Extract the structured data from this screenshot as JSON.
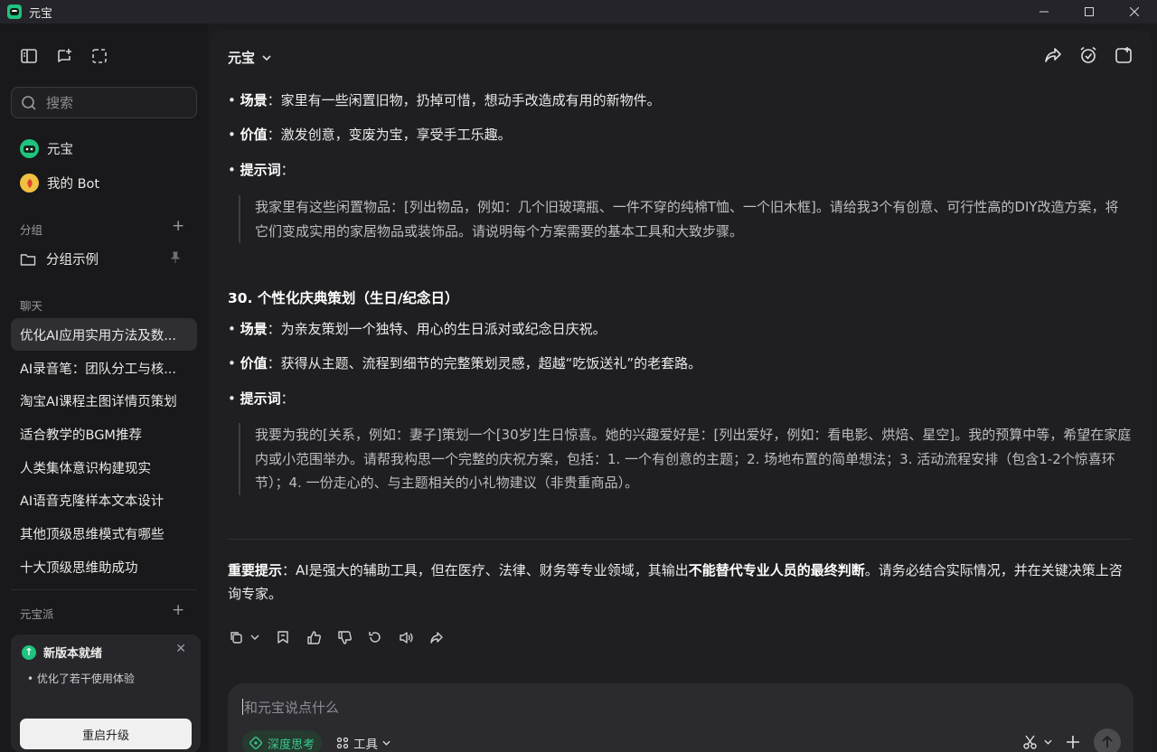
{
  "window": {
    "title": "元宝"
  },
  "sidebar": {
    "search_placeholder": "搜索",
    "nav": [
      {
        "label": "元宝",
        "icon": "yuanbao-logo-icon"
      },
      {
        "label": "我的 Bot",
        "icon": "bot-avatar-icon"
      }
    ],
    "groups_label": "分组",
    "group_example": "分组示例",
    "chats_label": "聊天",
    "chats": [
      "优化AI应用实用方法及数...",
      "AI录音笔：团队分工与核...",
      "淘宝AI课程主图详情页策划",
      "适合教学的BGM推荐",
      "人类集体意识构建现实",
      "AI语音克隆样本文本设计",
      "其他顶级思维模式有哪些",
      "十大顶级思维助成功"
    ],
    "yuanbao_pai_label": "元宝派",
    "update": {
      "title": "新版本就绪",
      "item": "优化了若干使用体验",
      "button": "重启升级"
    }
  },
  "main": {
    "model": "元宝",
    "b1_label": "场景",
    "b1_text": "：家里有一些闲置旧物，扔掉可惜，想动手改造成有用的新物件。",
    "b2_label": "价值",
    "b2_text": "：激发创意，变废为宝，享受手工乐趣。",
    "b3_label": "提示词",
    "b3_text": "：",
    "q1": "我家里有这些闲置物品：[列出物品，例如：几个旧玻璃瓶、一件不穿的纯棉T恤、一个旧木框]。请给我3个有创意、可行性高的DIY改造方案，将它们变成实用的家居物品或装饰品。请说明每个方案需要的基本工具和大致步骤。",
    "heading30": "30. 个性化庆典策划（生日/纪念日）",
    "c1_label": "场景",
    "c1_text": "：为亲友策划一个独特、用心的生日派对或纪念日庆祝。",
    "c2_label": "价值",
    "c2_text": "：获得从主题、流程到细节的完整策划灵感，超越“吃饭送礼”的老套路。",
    "c3_label": "提示词",
    "c3_text": "：",
    "q2": "我要为我的[关系，例如：妻子]策划一个[30岁]生日惊喜。她的兴趣爱好是：[列出爱好，例如：看电影、烘焙、星空]。我的预算中等，希望在家庭内或小范围举办。请帮我构思一个完整的庆祝方案，包括：1. 一个有创意的主题；2. 场地布置的简单想法；3. 活动流程安排（包含1-2个惊喜环节）；4. 一份走心的、与主题相关的小礼物建议（非贵重商品）。",
    "important_label": "重要提示",
    "important_text1": "：AI是强大的辅助工具，但在医疗、法律、财务等专业领域，其输出",
    "important_bold": "不能替代专业人员的最终判断",
    "important_text2": "。请务必结合实际情况，并在关键决策上咨询专家。"
  },
  "composer": {
    "placeholder": "和元宝说点什么",
    "deep_think": "深度思考",
    "tools": "工具"
  },
  "colors": {
    "accent": "#1fc37d",
    "background": "#1f1f22",
    "sidebar": "#19191b"
  }
}
